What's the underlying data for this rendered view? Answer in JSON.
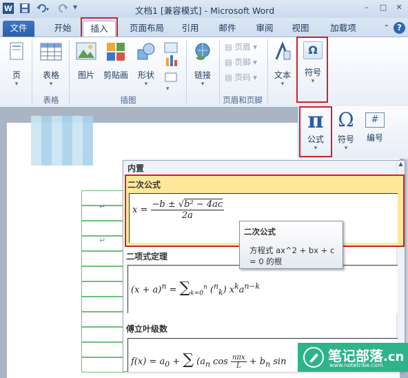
{
  "window": {
    "title": "文档1 [兼容模式] - Microsoft Word",
    "app_icon": "W",
    "qat": {
      "save_icon": "save-icon",
      "undo_icon": "undo-icon",
      "redo_icon": "redo-icon",
      "customize": "▾"
    },
    "controls": {
      "minimize": "–",
      "maximize": "□",
      "close": "✕"
    }
  },
  "tabs": [
    {
      "label": "文件"
    },
    {
      "label": "开始"
    },
    {
      "label": "插入"
    },
    {
      "label": "页面布局"
    },
    {
      "label": "引用"
    },
    {
      "label": "邮件"
    },
    {
      "label": "审阅"
    },
    {
      "label": "视图"
    },
    {
      "label": "加载项"
    }
  ],
  "ribbon": {
    "buttons": {
      "page": "页",
      "table": "表格",
      "picture": "图片",
      "clipart": "剪贴画",
      "shapes": "形状",
      "link": "链接",
      "header": "页眉",
      "footer": "页脚",
      "page_number": "页码",
      "textbox": "文本",
      "symbol": "符号"
    },
    "groups": {
      "tables": "表格",
      "illustrations": "插图",
      "header_footer": "页眉和页脚"
    }
  },
  "symbols_panel": {
    "equation": "公式",
    "symbol": "符号",
    "numbering": "编号",
    "equation_glyph": "π",
    "symbol_glyph": "Ω",
    "numbering_glyph": "#"
  },
  "gallery": {
    "header": "内置",
    "items": [
      {
        "title": "二次公式"
      },
      {
        "title": "二项式定理"
      },
      {
        "title": "傅立叶级数"
      }
    ]
  },
  "tooltip": {
    "title": "二次公式",
    "body": "方程式 ax^2 + bx + c = 0 的根"
  },
  "document": {
    "paragraph_mark": "↵"
  },
  "watermark": {
    "text": "笔记部落",
    "suffix": ".cn",
    "url": "www.notetribe.com"
  },
  "colors": {
    "accent_red": "#d0202a",
    "file_tab": "#2a5ea8",
    "highlight": "#fde89a",
    "watermark": "#2eb38a"
  }
}
